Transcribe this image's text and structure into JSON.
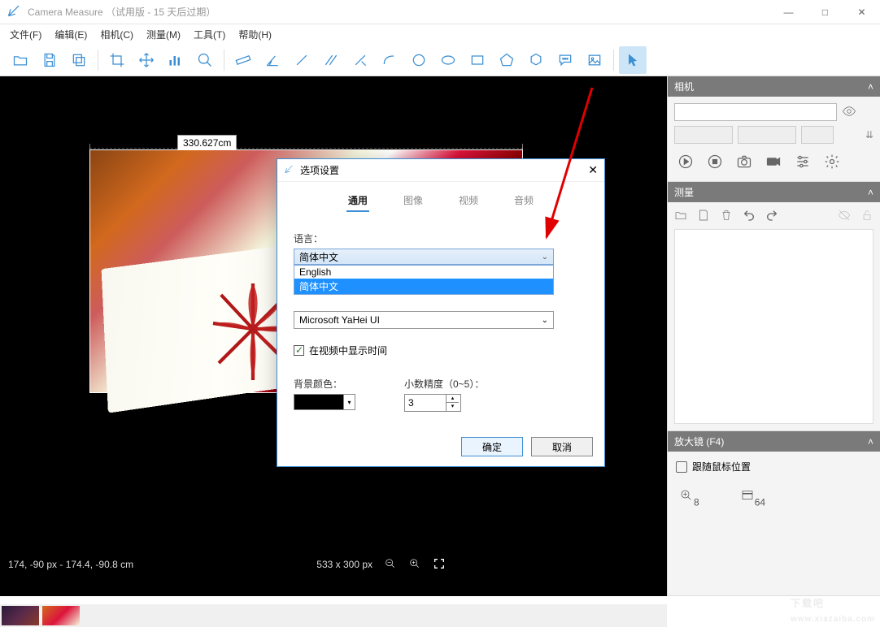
{
  "window": {
    "title": "Camera Measure （试用版 - 15 天后过期）"
  },
  "menu": {
    "file": "文件(F)",
    "edit": "编辑(E)",
    "camera": "相机(C)",
    "measure": "测量(M)",
    "tools": "工具(T)",
    "help": "帮助(H)"
  },
  "measurement": {
    "label": "330.627cm"
  },
  "status": {
    "coords": "174, -90 px - 174.4, -90.8 cm",
    "size": "533 x 300 px"
  },
  "panels": {
    "camera": {
      "title": "相机"
    },
    "measure": {
      "title": "测量"
    },
    "magnifier": {
      "title": "放大镜 (F4)",
      "followLabel": "跟随鼠标位置",
      "zoom8": "8",
      "zoom64": "64"
    }
  },
  "dialog": {
    "title": "选项设置",
    "tabs": {
      "general": "通用",
      "image": "图像",
      "video": "视频",
      "audio": "音频"
    },
    "languageLabel": "语言：",
    "languageValue": "简体中文",
    "options": {
      "english": "English",
      "chinese": "简体中文"
    },
    "fontValue": "Microsoft YaHei UI",
    "showTimeLabel": "在视频中显示时间",
    "bgColorLabel": "背景颜色：",
    "precisionLabel": "小数精度（0~5）：",
    "precisionValue": "3",
    "okLabel": "确定",
    "cancelLabel": "取消"
  },
  "watermark": {
    "text": "下载吧",
    "url": "www.xiazaiba.com"
  }
}
